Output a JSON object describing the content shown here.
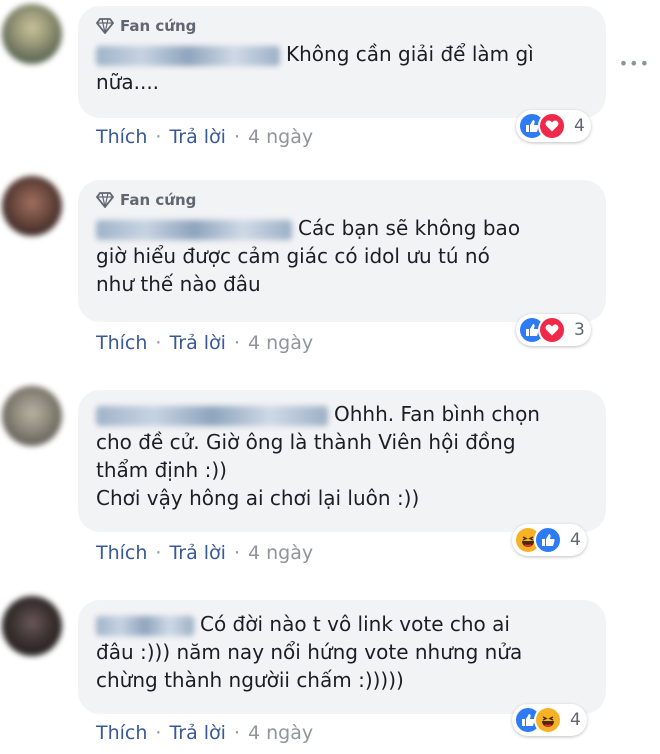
{
  "comments": [
    {
      "badge": "Fan cứng",
      "text_lines": [
        "Không cần giải để làm gì",
        "nữa...."
      ],
      "like": "Thích",
      "reply": "Trả lời",
      "time": "4 ngày",
      "reactions": [
        "like-icon",
        "love-icon"
      ],
      "reaction_count": "4"
    },
    {
      "badge": "Fan cứng",
      "text_lines": [
        "Các bạn sẽ không bao",
        "giờ hiểu được cảm giác có idol ưu tú nó",
        "như thế nào đâu"
      ],
      "like": "Thích",
      "reply": "Trả lời",
      "time": "4 ngày",
      "reactions": [
        "like-icon",
        "love-icon"
      ],
      "reaction_count": "3"
    },
    {
      "badge": "",
      "text_lines": [
        "Ohhh. Fan bình chọn",
        "cho đề cử. Giờ ông là thành Viên hội đồng",
        "thẩm định :))",
        "Chơi vậy hông ai chơi lại luôn :))"
      ],
      "like": "Thích",
      "reply": "Trả lời",
      "time": "4 ngày",
      "reactions": [
        "haha-icon",
        "like-icon"
      ],
      "reaction_count": "4"
    },
    {
      "badge": "",
      "text_lines": [
        "Có đời nào t vô link vote cho ai",
        "đâu :))) năm nay nổi hứng vote nhưng nửa",
        "chừng thành ngườii chấm :)))))"
      ],
      "like": "Thích",
      "reply": "Trả lời",
      "time": "4 ngày",
      "reactions": [
        "like-icon",
        "haha-icon"
      ],
      "reaction_count": "4"
    }
  ],
  "more_icon": "more-icon"
}
